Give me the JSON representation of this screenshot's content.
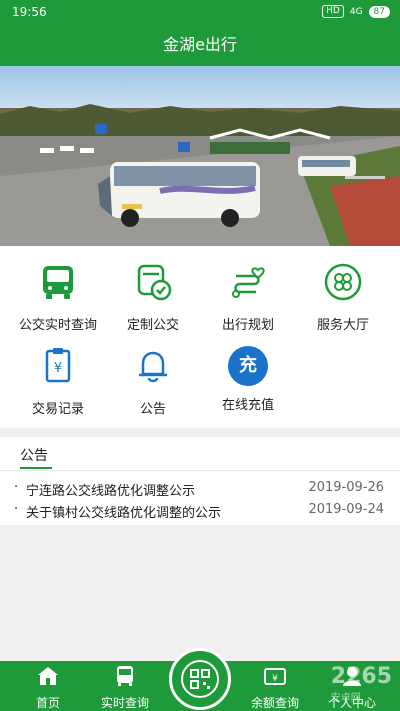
{
  "status": {
    "time": "19:56",
    "hd": "HD",
    "signal": "4G",
    "battery": "87"
  },
  "header": {
    "title": "金湖e出行"
  },
  "banner": {
    "slides": 4,
    "active_index": 0
  },
  "services": [
    {
      "label": "公交实时查询",
      "icon": "bus-icon"
    },
    {
      "label": "定制公交",
      "icon": "custom-bus-icon"
    },
    {
      "label": "出行规划",
      "icon": "route-icon"
    },
    {
      "label": "服务大厅",
      "icon": "service-hall-icon"
    },
    {
      "label": "交易记录",
      "icon": "receipt-icon"
    },
    {
      "label": "公告",
      "icon": "bell-icon"
    },
    {
      "label": "在线充值",
      "icon": "recharge-icon",
      "glyph": "充"
    }
  ],
  "notice": {
    "title": "公告",
    "items": [
      {
        "title": "宁连路公交线路优化调整公示",
        "date": "2019-09-26"
      },
      {
        "title": "关于镇村公交线路优化调整的公示",
        "date": "2019-09-24"
      }
    ]
  },
  "tabbar": {
    "items": [
      {
        "label": "首页",
        "icon": "home-icon"
      },
      {
        "label": "实时查询",
        "icon": "bus-icon"
      },
      {
        "label": "",
        "icon": "qr-scan-icon"
      },
      {
        "label": "余额查询",
        "icon": "balance-icon"
      },
      {
        "label": "个人中心",
        "icon": "user-icon"
      }
    ]
  },
  "watermark": {
    "text": "2265",
    "sub": "安卓网"
  },
  "colors": {
    "brand": "#1f9a3a",
    "accent_blue": "#1a73c8"
  }
}
